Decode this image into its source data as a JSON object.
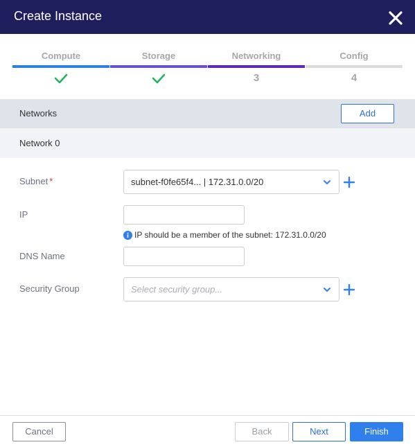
{
  "modal": {
    "title": "Create Instance"
  },
  "colors": {
    "header_bg": "#1f1f5e",
    "accent": "#2f80ed",
    "success": "#22b35e",
    "step_compute": "#2f80ed",
    "step_storage": "#6b4fd6",
    "step_networking": "#5b2bb8",
    "step_inactive": "#d9dbe0"
  },
  "steps": [
    {
      "label": "Compute",
      "status": "complete",
      "icon": "check-icon"
    },
    {
      "label": "Storage",
      "status": "complete",
      "icon": "check-icon"
    },
    {
      "label": "Networking",
      "status": "current",
      "number": "3"
    },
    {
      "label": "Config",
      "status": "pending",
      "number": "4"
    }
  ],
  "networks": {
    "label": "Networks",
    "add_label": "Add"
  },
  "network0": {
    "label": "Network 0"
  },
  "form": {
    "subnet_label": "Subnet",
    "required_mark": "*",
    "subnet_value": "subnet-f0fe65f4... | 172.31.0.0/20",
    "ip_label": "IP",
    "ip_value": "",
    "ip_hint": "IP should be a member of the subnet: 172.31.0.0/20",
    "dns_label": "DNS Name",
    "dns_value": "",
    "security_group_label": "Security Group",
    "security_group_placeholder": "Select security group..."
  },
  "footer": {
    "cancel_label": "Cancel",
    "back_label": "Back",
    "next_label": "Next",
    "finish_label": "Finish"
  }
}
